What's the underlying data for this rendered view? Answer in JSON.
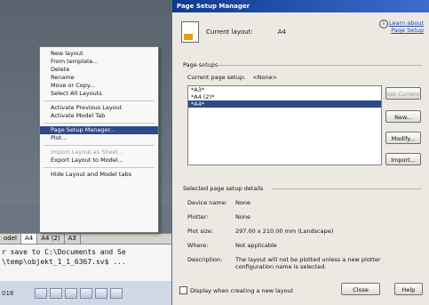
{
  "drawing_tabs": [
    "odel",
    "A4",
    "A4 (2)",
    "A3"
  ],
  "command_lines": [
    "r save to C:\\Documents and Se",
    "\\temp\\objekt_1_1_6367.sv$ ..."
  ],
  "status": {
    "coord": "018"
  },
  "context_menu": {
    "items": [
      {
        "label": "New layout",
        "state": "normal"
      },
      {
        "label": "From template...",
        "state": "normal"
      },
      {
        "label": "Delete",
        "state": "normal"
      },
      {
        "label": "Rename",
        "state": "normal"
      },
      {
        "label": "Move or Copy...",
        "state": "normal"
      },
      {
        "label": "Select All Layouts",
        "state": "normal"
      },
      {
        "label": "Activate Previous Layout",
        "state": "normal"
      },
      {
        "label": "Activate Model Tab",
        "state": "normal"
      },
      {
        "label": "Page Setup Manager...",
        "state": "highlight"
      },
      {
        "label": "Plot...",
        "state": "normal"
      },
      {
        "label": "Import Layout as Sheet...",
        "state": "disabled"
      },
      {
        "label": "Export Layout to Model...",
        "state": "normal"
      },
      {
        "label": "Hide Layout and Model tabs",
        "state": "normal"
      }
    ]
  },
  "dialog": {
    "title": "Page Setup Manager",
    "current_layout_label": "Current layout:",
    "current_layout_value": "A4",
    "learn_link_1": "Learn about",
    "learn_link_2": "Page Setup",
    "page_setups_label": "Page setups",
    "current_page_setup_label": "Current page setup:",
    "current_page_setup_value": "<None>",
    "setups": [
      {
        "name": "*A3*",
        "selected": false
      },
      {
        "name": "*A4 (2)*",
        "selected": false
      },
      {
        "name": "*A4*",
        "selected": true
      }
    ],
    "buttons": {
      "set_current": "Set Current",
      "new": "New...",
      "modify": "Modify...",
      "import": "Import..."
    },
    "details_label": "Selected page setup details",
    "details": [
      {
        "key": "Device name:",
        "value": "None"
      },
      {
        "key": "Plotter:",
        "value": "None"
      },
      {
        "key": "Plot size:",
        "value": "297.00 x 210.00 mm (Landscape)"
      },
      {
        "key": "Where:",
        "value": "Not applicable"
      },
      {
        "key": "Description:",
        "value": "The layout will not be plotted unless a new plotter configuration name is selected."
      }
    ],
    "checkbox_label": "Display when creating a new layout",
    "close_label": "Close",
    "help_label": "Help"
  }
}
